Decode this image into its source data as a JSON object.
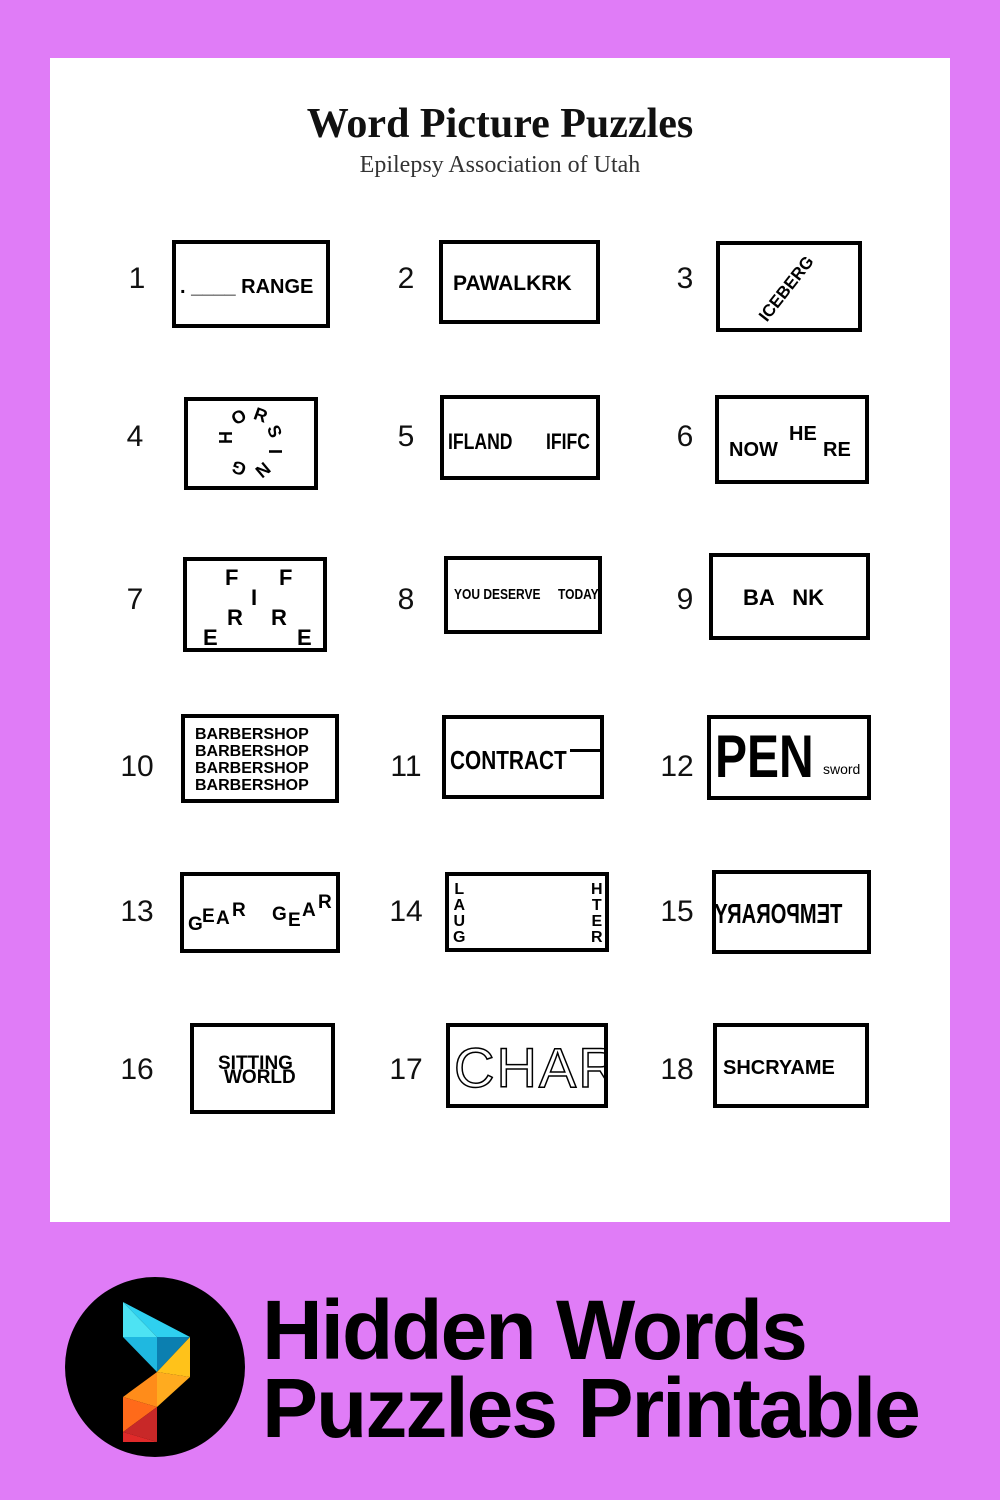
{
  "header": {
    "title": "Word Picture Puzzles",
    "subtitle": "Epilepsy Association of Utah"
  },
  "puzzles": [
    {
      "number": "1",
      "text": ". ____ RANGE"
    },
    {
      "number": "2",
      "text": "PAWALKRK"
    },
    {
      "number": "3",
      "text": "ICEBERG"
    },
    {
      "number": "4",
      "letters": [
        "H",
        "O",
        "R",
        "S",
        "I",
        "N",
        "G"
      ]
    },
    {
      "number": "5",
      "left": "IFLAND",
      "right": "IFIFC"
    },
    {
      "number": "6",
      "main1": "NOW",
      "sup": "HE",
      "main2": "RE"
    },
    {
      "number": "7",
      "letters": [
        "F",
        "F",
        "I",
        "R",
        "R",
        "E",
        "E"
      ]
    },
    {
      "number": "8",
      "left": "YOU DESERVE",
      "right": "TODAY"
    },
    {
      "number": "9",
      "text": "BA   NK"
    },
    {
      "number": "10",
      "lines": [
        "BARBERSHOP",
        "BARBERSHOP",
        "BARBERSHOP",
        "BARBERSHOP"
      ]
    },
    {
      "number": "11",
      "text": "CONTRACT"
    },
    {
      "number": "12",
      "big": "PEN",
      "small": "sword"
    },
    {
      "number": "13",
      "word1": [
        "G",
        "E",
        "A",
        "R"
      ],
      "word2": [
        "G",
        "E",
        "A",
        "R"
      ]
    },
    {
      "number": "14",
      "left": [
        "L",
        "A",
        "U",
        "G"
      ],
      "right": [
        "H",
        "T",
        "E",
        "R"
      ]
    },
    {
      "number": "15",
      "text": "TEMPORARY"
    },
    {
      "number": "16",
      "top": "SITTING",
      "bottom": "WORLD"
    },
    {
      "number": "17",
      "text": "CHART"
    },
    {
      "number": "18",
      "text": "SHCRYAME"
    }
  ],
  "banner": {
    "line1": "Hidden Words",
    "line2": "Puzzles Printable",
    "logo_colors": [
      "#4de3f3",
      "#1fb8e0",
      "#0b7fb0",
      "#ffc21a",
      "#ff9a1a",
      "#ff6a1a",
      "#e02a2a"
    ],
    "background": "#e07cf7"
  }
}
